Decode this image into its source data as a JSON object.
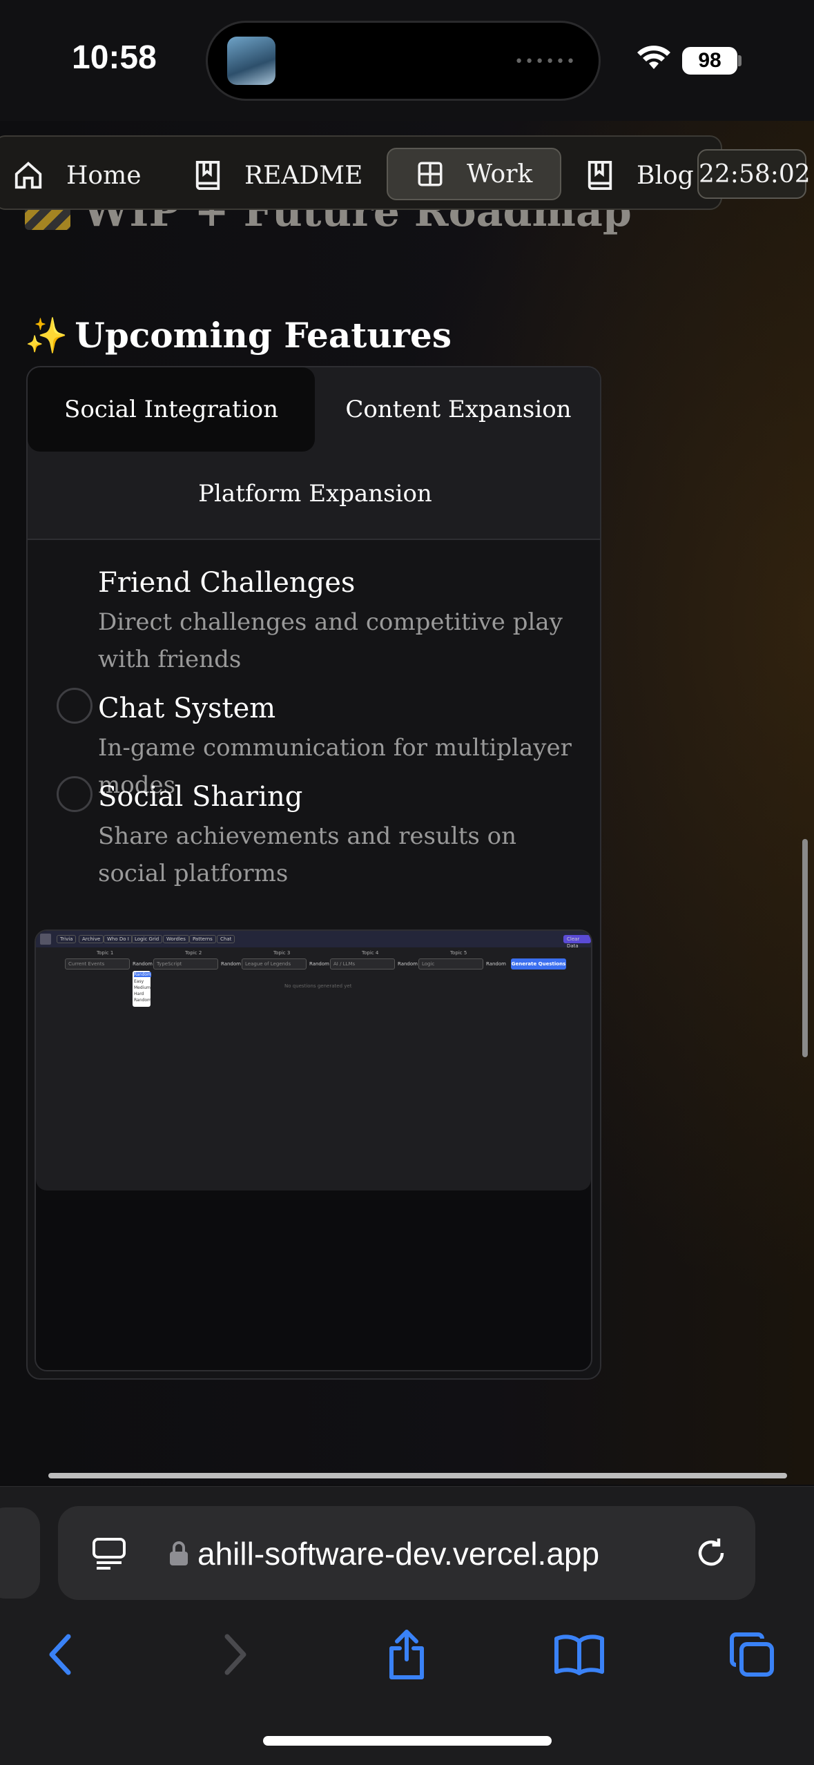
{
  "status_bar": {
    "time": "10:58",
    "battery": "98"
  },
  "nav": {
    "items": [
      {
        "label": "Home",
        "icon": "home-icon"
      },
      {
        "label": "README",
        "icon": "book-icon"
      },
      {
        "label": "Work",
        "icon": "grid-icon",
        "active": true
      },
      {
        "label": "Blog",
        "icon": "book-icon"
      }
    ],
    "clock": "22:58:02"
  },
  "roadmap_heading": "WIP + Future Roadmap",
  "section_title": "Upcoming Features",
  "tabs": [
    {
      "label": "Social Integration",
      "active": true
    },
    {
      "label": "Content Expansion"
    },
    {
      "label": "Platform Expansion"
    }
  ],
  "features": [
    {
      "title": "Friend Challenges",
      "desc": "Direct challenges and competitive play with friends"
    },
    {
      "title": "Chat System",
      "desc": "In-game communication for multiplayer modes"
    },
    {
      "title": "Social Sharing",
      "desc": "Share achievements and results on social platforms"
    }
  ],
  "screenshot": {
    "nav": [
      "Trivia",
      "Archive",
      "Who Do I",
      "Logic Grid",
      "Wordles",
      "Patterns",
      "Chat"
    ],
    "corner_button": "Clear Data",
    "topic_labels": [
      "Topic 1",
      "Topic 2",
      "Topic 3",
      "Topic 4",
      "Topic 5"
    ],
    "topic_values": [
      "Current Events",
      "TypeScript",
      "League of Legends",
      "AI / LLMs",
      "Logic"
    ],
    "difficulty": "Random",
    "dropdown_options": [
      "Random",
      "Easy",
      "Medium",
      "Hard",
      "Random"
    ],
    "generate_button": "Generate Questions",
    "empty_text": "No questions generated yet"
  },
  "safari": {
    "url": "ahill-software-dev.vercel.app"
  }
}
